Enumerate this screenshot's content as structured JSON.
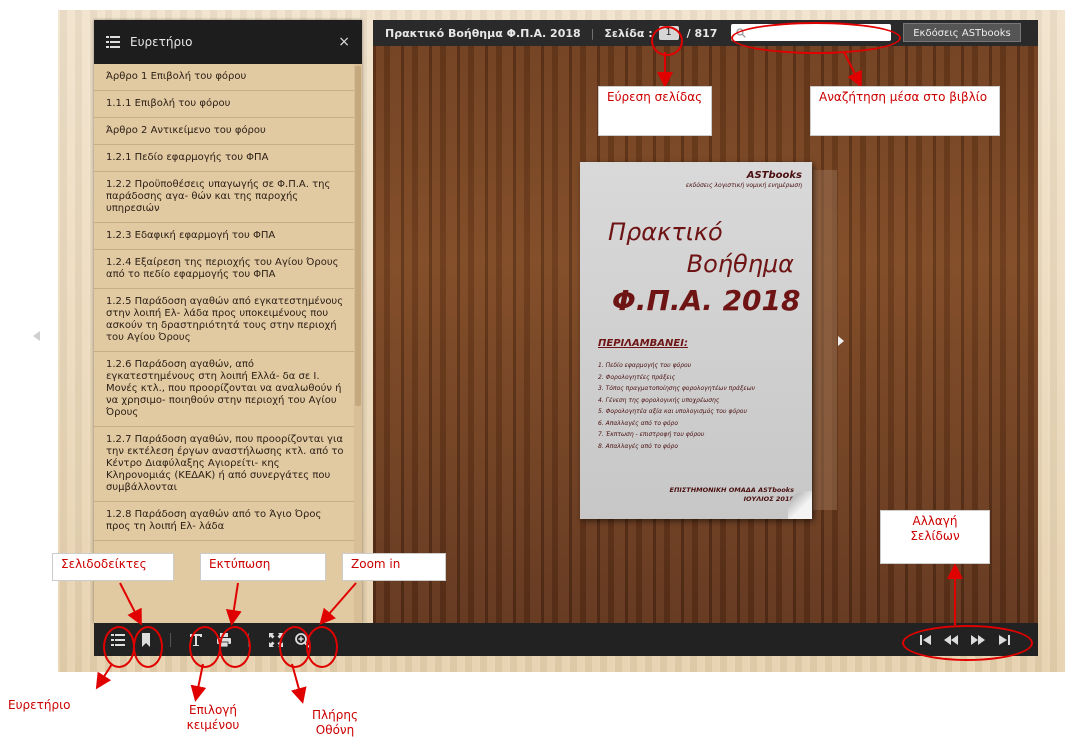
{
  "index_panel": {
    "title": "Ευρετήριο",
    "close_symbol": "×",
    "items": [
      "Άρθρο 1 Επιβολή του φόρου",
      "1.1.1 Επιβολή του φόρου",
      "Άρθρο 2 Αντικείμενο του φόρου",
      "1.2.1  Πεδίο εφαρμογής του ΦΠΑ",
      "1.2.2  Προϋποθέσεις υπαγωγής σε Φ.Π.Α. της παράδοσης αγα- θών και της παροχής υπηρεσιών",
      "1.2.3 Εδαφική εφαρμογή του ΦΠΑ",
      "1.2.4  Εξαίρεση της περιοχής του Αγίου Όρους από το πεδίο εφαρμογής του ΦΠΑ",
      "1.2.5  Παράδοση αγαθών από εγκατεστημένους στην λοιπή Ελ- λάδα προς υποκειμένους που ασκούν τη δραστηριότητά τους στην  περιοχή του Αγίου Όρους",
      "1.2.6 Παράδοση αγαθών, από εγκατεστημένους στη λοιπή Ελλά- δα σε Ι. Μονές κτλ., που προορίζονται να αναλωθούν ή να χρησιμο- ποιηθούν στην περιοχή του Αγίου Όρους",
      "1.2.7  Παράδοση αγαθών, που προορίζονται για την εκτέλεση έργων αναστήλωσης κτλ. από το Κέντρο Διαφύλαξης Αγιορείτι- κης Κληρονομιάς (ΚΕΔΑΚ) ή από συνεργάτες που συμβάλλονται",
      "1.2.8  Παράδοση αγαθών από το Άγιο Όρος προς τη λοιπή Ελ- λάδα"
    ]
  },
  "toolbar": {
    "book_title": "Πρακτικό Βοήθημα Φ.Π.Α. 2018",
    "separator": "|",
    "page_label": "Σελίδα :",
    "current_page": "1",
    "total_pages": "/ 817",
    "search_placeholder": "",
    "brand_button": "Εκδόσεις ASTbooks"
  },
  "book_cover": {
    "brand": "ASTbooks",
    "subtitle": "εκδόσεις λογιστική νομική ενημέρωση",
    "title_line1": "Πρακτικό",
    "title_line2": "Βοήθημα",
    "title_line3": "Φ.Π.Α. 2018",
    "includes_heading": "ΠΕΡΙΛΑΜΒΑΝΕΙ:",
    "includes_list": [
      "1. Πεδίο εφαρμογής του φόρου",
      "2. Φορολογητέες πράξεις",
      "3. Τόπος πραγματοποίησης φορολογητέων πράξεων",
      "4. Γένεση της φορολογικής υποχρέωσης",
      "5. Φορολογητέα αξία και υπολογισμός του φόρου",
      "6. Απαλλαγές από το φόρο",
      "7. Έκπτωση - επιστροφή του φόρου",
      "8. Απαλλαγές από το φόρο"
    ],
    "author": "ΕΠΙΣΤΗΜΟΝΙΚΗ ΟΜΑΔΑ ASTbooks",
    "date": "ΙΟΥΛΙΟΣ 2018"
  },
  "annotations": {
    "find_page": "Εύρεση σελίδας",
    "search_in_book": "Αναζήτηση μέσα στο βιβλίο",
    "change_pages": "Αλλαγή Σελίδων",
    "bookmarks": "Σελιδοδείκτες",
    "print": "Εκτύπωση",
    "zoom_in": "Zoom in",
    "index": "Ευρετήριο",
    "select_text": "Επιλογή κειμένου",
    "full_screen": "Πλήρης Οθόνη"
  },
  "colors": {
    "annotation": "#cc0000",
    "panel_bg": "#e1c9a2",
    "toolbar_bg": "#222222",
    "wood": "#6b3a1c"
  },
  "icons": {
    "index": "list-icon",
    "bookmarks": "bookmark-icon",
    "select_text": "text-select-icon",
    "print": "print-icon",
    "full_screen": "fullscreen-icon",
    "zoom_in": "zoom-in-icon",
    "first": "first-page-icon",
    "prev": "previous-page-icon",
    "next": "next-page-icon",
    "last": "last-page-icon",
    "search": "search-icon"
  }
}
